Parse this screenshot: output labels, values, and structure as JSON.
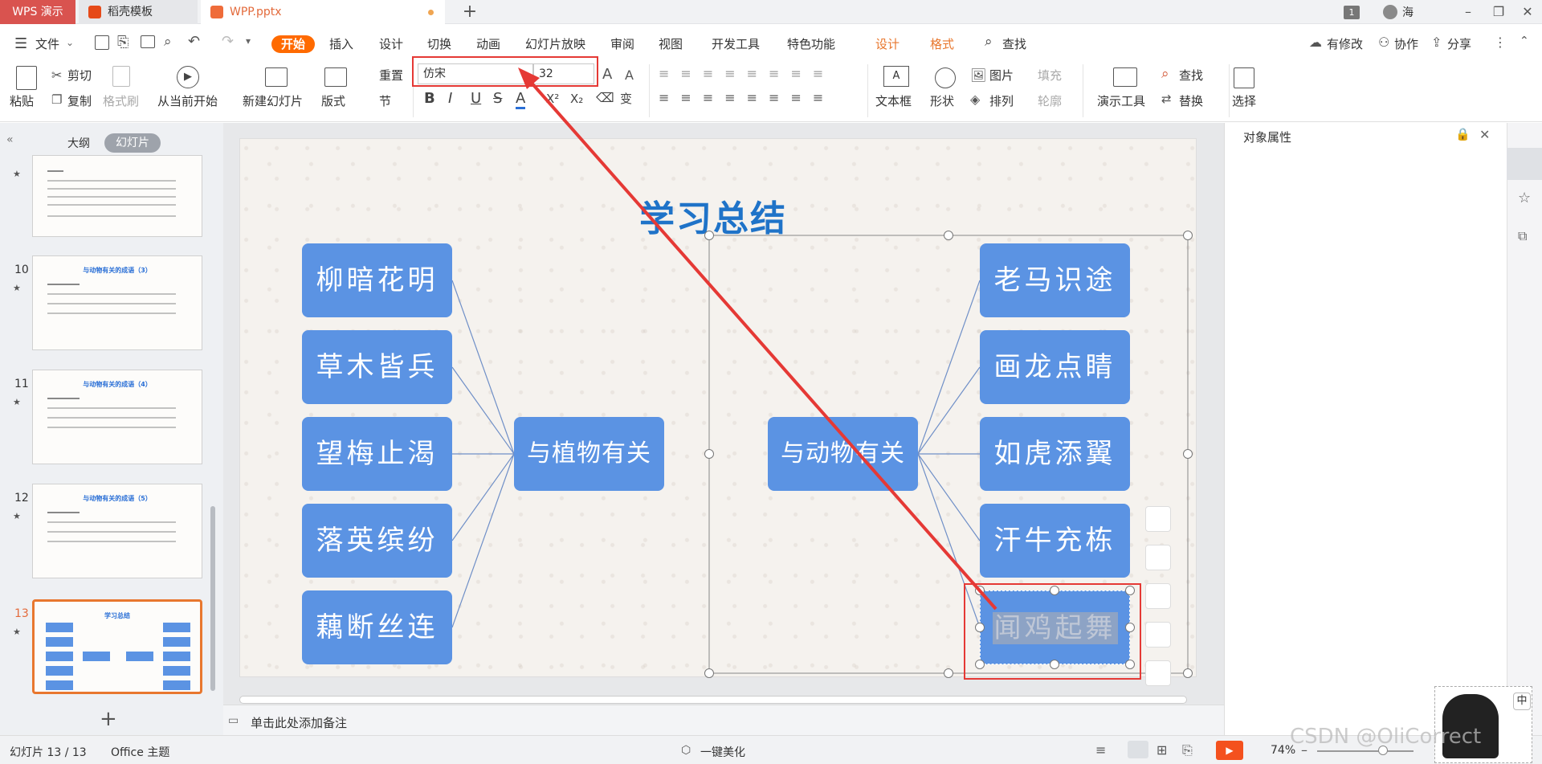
{
  "titlebar": {
    "logo": "WPS 演示",
    "tabs": [
      "稻壳模板",
      "WPP.pptx"
    ],
    "new_tab": "+",
    "badge": "1",
    "user": "海"
  },
  "menubar": {
    "file": "文件",
    "items": [
      "开始",
      "插入",
      "设计",
      "切换",
      "动画",
      "幻灯片放映",
      "审阅",
      "视图",
      "开发工具",
      "特色功能"
    ],
    "context_items": [
      "设计",
      "格式"
    ],
    "search": "查找",
    "right": [
      "有修改",
      "协作",
      "分享"
    ]
  },
  "ribbon": {
    "paste": "粘贴",
    "cut": "剪切",
    "copy": "复制",
    "format_painter": "格式刷",
    "play_from_current": "从当前开始",
    "new_slide": "新建幻灯片",
    "layout": "版式",
    "reset": "重置",
    "section": "节",
    "font_name": "仿宋",
    "font_size": "32",
    "textbox": "文本框",
    "shape": "形状",
    "picture": "图片",
    "fill": "填充",
    "arrange": "排列",
    "outline": "轮廓",
    "present_tools": "演示工具",
    "find": "查找",
    "replace": "替换",
    "select": "选择"
  },
  "leftpanel": {
    "tab_outline": "大纲",
    "tab_slides": "幻灯片",
    "slides": [
      {
        "num": "10",
        "title": "与动物有关的成语（3）"
      },
      {
        "num": "11",
        "title": "与动物有关的成语（4）"
      },
      {
        "num": "12",
        "title": "与动物有关的成语（5）"
      },
      {
        "num": "13",
        "title": "学习总结"
      }
    ],
    "add": "+"
  },
  "slide": {
    "title": "学习总结",
    "left_items": [
      "柳暗花明",
      "草木皆兵",
      "望梅止渴",
      "落英缤纷",
      "藕断丝连"
    ],
    "left_center": "与植物有关",
    "right_center": "与动物有关",
    "right_items": [
      "老马识途",
      "画龙点睛",
      "如虎添翼",
      "汗牛充栋",
      "闻鸡起舞"
    ]
  },
  "rightpanel": {
    "title": "对象属性"
  },
  "notes": {
    "placeholder": "单击此处添加备注"
  },
  "statusbar": {
    "slide_info": "幻灯片 13 / 13",
    "theme": "Office 主题",
    "beautify": "一键美化",
    "zoom": "74%",
    "ime": "中",
    "watermark": "CSDN @OliCorrect"
  }
}
